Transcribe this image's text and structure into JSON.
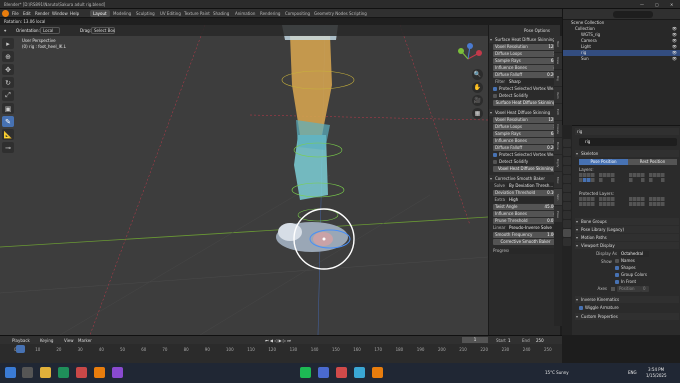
{
  "window": {
    "title": "Blender* [D:\\RS891\\Naruto\\Sakura adult rig.blend]",
    "controls": [
      "—",
      "▢",
      "✕"
    ]
  },
  "menubar": {
    "items": [
      "File",
      "Edit",
      "Render",
      "Window",
      "Help"
    ],
    "workspaces": [
      "Layout",
      "Modeling",
      "Sculpting",
      "UV Editing",
      "Texture Paint",
      "Shading",
      "Animation",
      "Rendering",
      "Compositing",
      "Geometry Nodes",
      "Scripting"
    ],
    "active_workspace": "Layout",
    "scene_label": "Scene",
    "view_layer_label": "ViewLayer"
  },
  "status_line": "Rotation: 13.06 local",
  "viewport": {
    "header": {
      "orientation_label": "Orientation:",
      "orientation_value": "Local",
      "drag_label": "Drag:",
      "drag_value": "Select Box"
    },
    "overlay": {
      "line1": "User Perspective",
      "line2": "(0) rig : foot_heel_IK.L"
    },
    "pose_options": "Pose Options",
    "tools": [
      "▸",
      "⊕",
      "✥",
      "↻",
      "⤢",
      "▣",
      "✎",
      "📐",
      "⊸"
    ],
    "active_tool_index": 6,
    "nav_buttons": [
      "🔍",
      "✋",
      "🎥",
      "▦"
    ]
  },
  "npanel": {
    "sections": [
      {
        "title": "Surface Heat Diffuse Skinning",
        "fields": [
          {
            "label": "Voxel Resolution",
            "value": "128"
          },
          {
            "label": "Diffuse Loops",
            "value": "5"
          },
          {
            "label": "Sample Rays",
            "value": "64"
          },
          {
            "label": "Influence Bones",
            "value": "4"
          },
          {
            "label": "Diffuse Falloff",
            "value": "0.20"
          }
        ],
        "filter": {
          "label": "Filter",
          "value": "Sharp"
        },
        "checks": [
          {
            "label": "Protect Selected Vertex We...",
            "on": true
          },
          {
            "label": "Detect Solidify",
            "on": false
          }
        ],
        "button": "Surface Heat Diffuse Skinning"
      },
      {
        "title": "Voxel Heat Diffuse Skinning",
        "fields": [
          {
            "label": "Voxel Resolution",
            "value": "128"
          },
          {
            "label": "Diffuse Loops",
            "value": "5"
          },
          {
            "label": "Sample Rays",
            "value": "64"
          },
          {
            "label": "Influence Bones",
            "value": "4"
          },
          {
            "label": "Diffuse Falloff",
            "value": "0.20"
          }
        ],
        "checks": [
          {
            "label": "Protect Selected Vertex We...",
            "on": true
          },
          {
            "label": "Detect Solidify",
            "on": false
          }
        ],
        "button": "Voxel Heat Diffuse Skinning"
      },
      {
        "title": "Corrective Smooth Baker",
        "solve": {
          "label": "Solve",
          "value": "By Deviation Thresh..."
        },
        "fields": [
          {
            "label": "Deviation Threshold",
            "value": "0.10"
          }
        ],
        "extra": {
          "label": "Extra",
          "value": "High"
        },
        "fields2": [
          {
            "label": "Twist Angle",
            "value": "45.00"
          },
          {
            "label": "Influence Bones",
            "value": "4"
          },
          {
            "label": "Prune Threshold",
            "value": "0.01"
          }
        ],
        "linear": {
          "label": "Linear",
          "value": "Pseudo-Inverse Solve"
        },
        "fields3": [
          {
            "label": "Smooth Frequency",
            "value": "1.00"
          }
        ],
        "button": "Corrective Smooth Baker",
        "progress_label": "Progress:"
      }
    ],
    "side_tabs": [
      "Tool",
      "View",
      "Rig",
      "Item",
      "Edit",
      "Create",
      "Bone",
      "Rigify",
      "Misc",
      "Skin",
      "Pose"
    ]
  },
  "outliner": {
    "rows": [
      {
        "label": "Scene Collection",
        "indent": 0,
        "selected": false
      },
      {
        "label": "Collection",
        "indent": 1,
        "selected": false
      },
      {
        "label": "WGTS_rig",
        "indent": 2,
        "selected": false
      },
      {
        "label": "Camera",
        "indent": 2,
        "selected": false
      },
      {
        "label": "Light",
        "indent": 2,
        "selected": false
      },
      {
        "label": "rig",
        "indent": 2,
        "selected": true
      },
      {
        "label": "Sun",
        "indent": 2,
        "selected": false
      }
    ]
  },
  "properties": {
    "breadcrumb": "rig",
    "object_name": "rig",
    "skeleton": {
      "title": "Skeleton",
      "pose_position": "Pose Position",
      "rest_position": "Rest Position",
      "layers_label": "Layers:",
      "protected_label": "Protected Layers:"
    },
    "collapsed": [
      "Bone Groups",
      "Pose Library (Legacy)",
      "Motion Paths"
    ],
    "viewport_display": {
      "title": "Viewport Display",
      "display_as_label": "Display As",
      "display_as_value": "Octahedral",
      "show_label": "Show",
      "checks": [
        {
          "label": "Names",
          "on": false
        },
        {
          "label": "Shapes",
          "on": true
        },
        {
          "label": "Group Colors",
          "on": true
        },
        {
          "label": "In Front",
          "on": true
        }
      ],
      "axes_label": "Axes",
      "position_label": "Position",
      "position_value": "0"
    },
    "bottom_sections": [
      "Inverse Kinematics",
      "Wiggle Armature",
      "Custom Properties"
    ],
    "wiggle_checked": true
  },
  "timeline": {
    "header": [
      "Playback",
      "Keying",
      "View",
      "Marker"
    ],
    "current_frame": "1",
    "start_label": "Start",
    "start_value": "1",
    "end_label": "End",
    "end_value": "250",
    "ticks": [
      "0",
      "10",
      "20",
      "30",
      "40",
      "50",
      "60",
      "70",
      "80",
      "90",
      "100",
      "110",
      "120",
      "130",
      "140",
      "150",
      "160",
      "170",
      "180",
      "190",
      "200",
      "210",
      "220",
      "230",
      "240",
      "250"
    ],
    "statusbar": [
      "Confirm",
      "Cancel",
      "X Axis",
      "Y Axis",
      "Z Axis",
      "X Plane",
      "Y Plane",
      "Z Plane",
      "Clear Constraints",
      "Snap Invert",
      "Snap Toggle",
      "Move",
      "Rotate",
      "Resize",
      "Automatic Constraint",
      "Automatic Constraint Plane",
      "Precision Mode"
    ]
  },
  "taskbar": {
    "weather": "15°C Sunny",
    "lang": "ENG",
    "time": "3:54 PM",
    "date": "1/15/2025"
  },
  "colors": {
    "accent": "#4772b3",
    "selection": "#334d80",
    "viewport_bg": "#3d3d3d",
    "panel_bg": "#2b2b2b"
  }
}
